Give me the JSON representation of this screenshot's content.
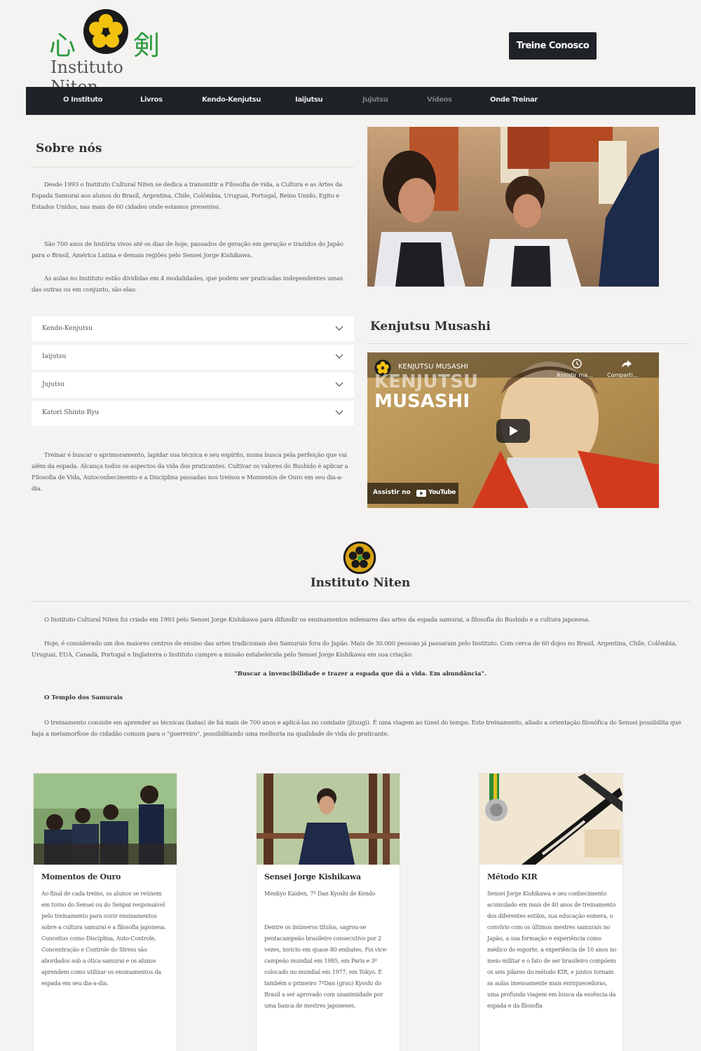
{
  "header": {
    "kanji_left": "心",
    "kanji_right": "剣",
    "logo_name": "Instituto Niten",
    "cta_label": "Treine Conosco"
  },
  "nav": [
    "O Instituto",
    "Livros",
    "Kendo-Kenjutsu",
    "Iaijutsu",
    "Jujutsu",
    "Vídeos",
    "Onde Treinar"
  ],
  "about": {
    "title": "Sobre nós",
    "p1": "Desde 1993 o Instituto Cultural Niten se dedica a transmitir a Filosofia de vida, a Cultura e as Artes da Espada Samurai aos alunos do Brasil, Argentina, Chile, Colômbia, Uruguai, Portugal, Reino Unido, Egito e Estados Unidos, nas mais de 60 cidades onde estamos presentes.",
    "p2": "São 700 anos de história vivos até os dias de hoje, passados de geração em geração e trazidos do Japão para o Brasil, América Latina e demais regiões pelo Sensei Jorge Kishikawa.",
    "p3": "As aulas no Instituto estão divididas em 4 modalidades, que podem ser praticadas independentes umas das outras ou em conjunto, são elas:",
    "accordion": [
      "Kendo-Kenjutsu",
      "Iaijutsu",
      "Jujutsu",
      "Katori Shinto Ryu"
    ],
    "p4": "Treinar é buscar o aprimoramento, lapidar sua técnica e seu espírito, numa busca pela perfeição que vai além da espada. Alcança todos os aspectos da vida dos praticantes. Cultivar os valores do Bushido é aplicar a Filosofia de Vida, Autoconhecimento e a Disciplina passadas nos treinos e Momentos de Ouro em seu dia-a-dia."
  },
  "video": {
    "heading": "Kenjutsu Musashi",
    "channel_title": "KENJUTSU MUSASHI",
    "overlay_line1": "KENJUTSU",
    "overlay_line2": "MUSASHI",
    "watch_later": "Assistir ma...",
    "share": "Comparti...",
    "watch_on": "Assistir no",
    "youtube": "YouTube"
  },
  "institute": {
    "title": "Instituto Niten",
    "p1": "O Instituto Cultural Niten foi criado em 1993 pelo Sensei Jorge Kishikawa para difundir os ensinamentos milenares das artes da espada samurai, a filosofia do Bushido e a cultura japonesa.",
    "p2": "Hoje, é considerado um dos maiores centros de ensino das artes tradicionais dos Samurais fora do Japão. Mais de 30.000 pessoas já passaram pelo Instituto. Com cerca de 60 dojos no Brasil, Argentina, Chile, Colômbia, Uruguai, EUA, Canadá, Portugal e Inglaterra o Instituto cumpre a missão estabelecida pelo Sensei Jorge Kishikawa em sua criação:",
    "quote": "\"Buscar a invencibilidade e trazer a espada que dá a vida. Em abundância\".",
    "subtitle": "O Templo dos Samurais",
    "p3": "O treinamento consiste em aprender as técnicas (katas) de há mais de 700 anos e aplicá-las no combate (jitsugi). É uma viagem ao túnel do tempo. Este treinamento, aliado a orientação filosófica do Sensei possibilita que haja a metamorfose do cidadão comum para o \"guerreiro\", possibilitando uma melhoria na qualidade de vida do praticante."
  },
  "cards": [
    {
      "title": "Momentos de Ouro",
      "text": "Ao final de cada treino, os alunos se reúnem em torno do Sensei ou do Senpai responsável pelo treinamento para ouvir ensinamentos sobre a cultura samurai e a filosofia japonesa. Conceitos como Disciplina, Auto-Controle, Concentração e Controle do Stress são abordados sob a ótica samurai e os alunos aprendem como utilizar os ensinamentos da espada em seu dia-a-dia."
    },
    {
      "title": "Sensei Jorge Kishikawa",
      "text1": "Menkyo Kaiden, 7º Dan Kyoshi de Kendo",
      "text2": "Dentre os inúmeros títulos, sagrou-se pentacampeão brasileiro consecutivo por 2 vezes, invicto em quase 80 embates. Foi vice-campeão mundial em 1985, em Paris e 3º colocado no mundial em 1977, em Tokyo. É também o primeiro 7ºDan (grau) Kyoshi do Brasil a ser aprovado com unanimidade por uma banca de mestres japoneses."
    },
    {
      "title": "Método KIR",
      "text": "Sensei Jorge Kishikawa e seu conhecimento acumulado em mais de 40 anos de treinamento dos diferentes estilos, sua educação esmera, o convívio com os últimos mestres samurais no Japão, a sua formação e experiência como médico do esporte, a experiência de 10 anos no meio militar e o fato de ser brasileiro compõem os seis pilares do método KIR, e juntos tornam as aulas imensamente mais enriquecedoras, uma profunda viagem em busca da essência da espada e da filosofia"
    }
  ],
  "colors": {
    "background": "#f4f3f1",
    "dark": "#1f2226",
    "green": "#2f9b3f",
    "mon_yellow": "#f2c20f"
  }
}
